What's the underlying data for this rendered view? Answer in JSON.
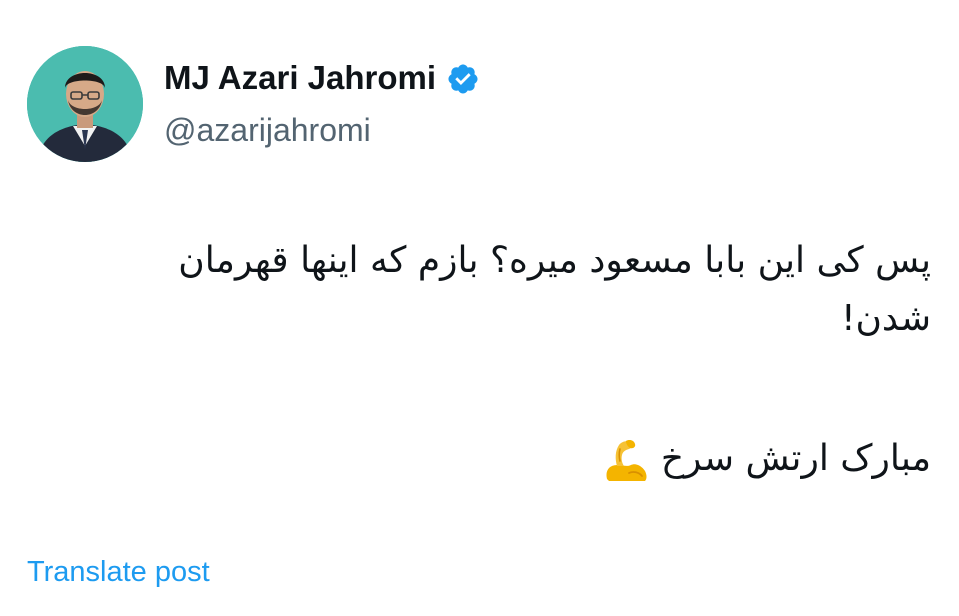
{
  "author": {
    "display_name": "MJ Azari Jahromi",
    "handle": "@azarijahromi",
    "verified": true,
    "verified_icon": "verified-badge-icon",
    "avatar_icon": "profile-avatar"
  },
  "post": {
    "line1": "پس کی این بابا مسعود میره؟ بازم که اینها قهرمان",
    "line2": "شدن!",
    "line3": "مبارک ارتش سرخ",
    "emoji_icon": "flexed-biceps-icon"
  },
  "actions": {
    "translate_label": "Translate post"
  },
  "colors": {
    "text": "#0f1419",
    "secondary": "#536471",
    "link": "#1d9bf0",
    "verified": "#1d9bf0"
  }
}
